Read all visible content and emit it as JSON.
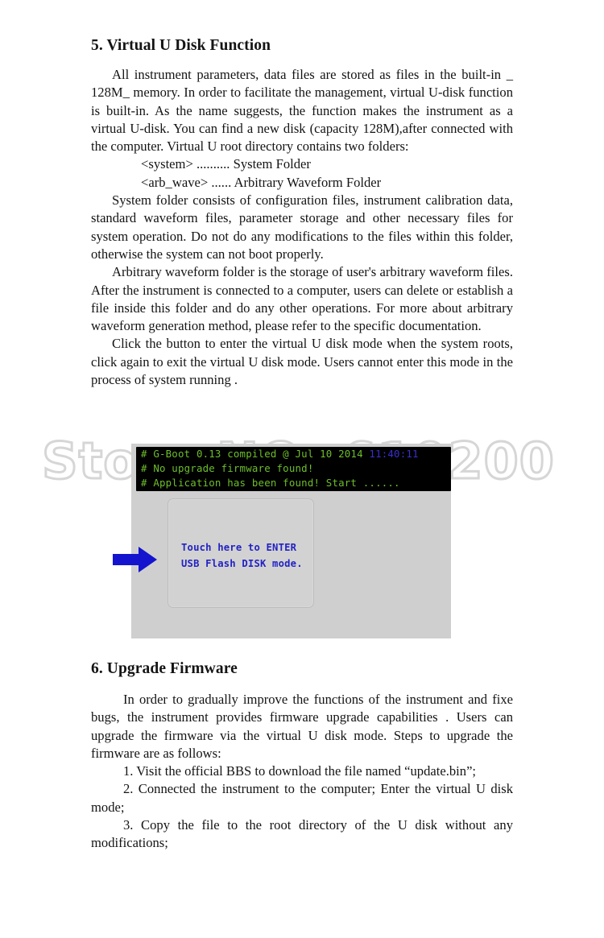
{
  "document": {
    "sections": [
      {
        "id": "virtual-u-disk",
        "heading": "5. Virtual U Disk Function",
        "paragraphs": [
          "All instrument parameters, data files are stored as files in the built-in _ 128M_ memory. In order to facilitate the management, virtual U-disk function is built-in. As the name suggests, the function makes the instrument as a virtual U-disk. You can find a new disk (capacity 128M),after connected with the computer. Virtual U root directory contains two folders:",
          "System folder consists of configuration files, instrument calibration data, standard waveform files, parameter storage and other necessary files for system operation. Do not do any modifications to the files within this folder, otherwise the system can not boot properly.",
          "Arbitrary waveform folder is the storage of user's arbitrary waveform files. After the instrument is connected to a computer, users can delete or establish a file inside this folder and do any other operations. For more about arbitrary waveform generation method, please refer to the specific documentation.",
          "Click the button to  enter the virtual U disk mode when the system roots, click again to exit the virtual U disk mode. Users cannot enter this mode in the process of system running ."
        ],
        "folder_list": [
          "<system> .......... System Folder",
          "<arb_wave> ...... Arbitrary Waveform Folder"
        ]
      },
      {
        "id": "upgrade-firmware",
        "heading": "6. Upgrade Firmware",
        "paragraphs": [
          "In order to gradually improve the functions of the instrument and  fixe  bugs,  the  instrument  provides  firmware  upgrade capabilities . Users can upgrade the firmware via the virtual U disk mode. Steps to upgrade the  firmware are as follows:"
        ],
        "steps": [
          "1. Visit  the  official  BBS  to  download  the  file  named “update.bin”;",
          "2. Connected the instrument  to the computer; Enter the virtual U disk mode;",
          "3. Copy the file  to the root directory of  the U disk without any modifications;"
        ]
      }
    ]
  },
  "figure": {
    "name": "virtual-u-disk-screen",
    "terminal": {
      "background_color": "#000000",
      "text_color": "#6ebe2b",
      "time_color": "#3a2fd0",
      "lines": [
        "# G-Boot 0.13 compiled @ Jul 10 2014 ",
        "# No upgrade firmware found!",
        "# Application has been found! Start ......"
      ],
      "build_time": "11:40:11"
    },
    "touch_button": {
      "line1": "Touch here to ENTER",
      "line2": "USB Flash DISK mode.",
      "text_color": "#2222c4",
      "panel_color": "#d2d2d2"
    },
    "arrow": {
      "color": "#1414cf",
      "direction": "right"
    },
    "panel_background": "#cfcfcf"
  },
  "watermark": {
    "text": "Store NO: 610200",
    "color": "#787878"
  }
}
